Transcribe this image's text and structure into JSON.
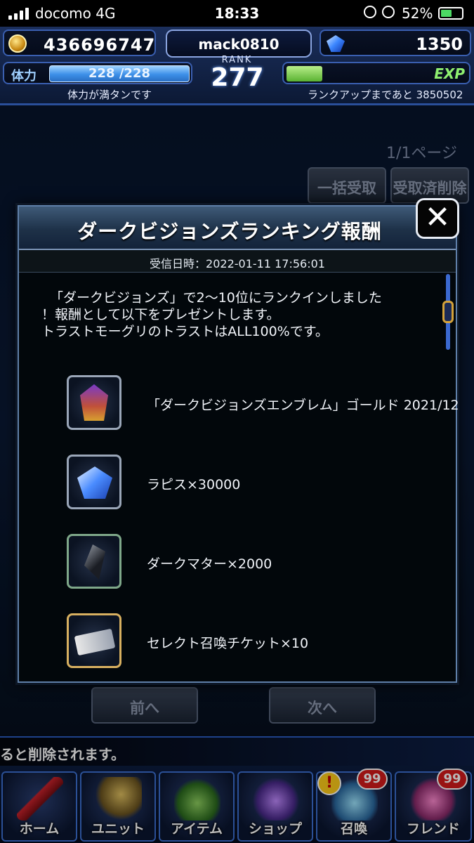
{
  "status_bar": {
    "carrier": "docomo   4G",
    "time": "18:33",
    "battery": "52%"
  },
  "header": {
    "gil": "436696747",
    "player_name": "mack0810",
    "lapis": "1350",
    "rank_label": "RANK",
    "rank": "277",
    "stamina_label": "体力",
    "stamina": "228 /228",
    "stamina_status": "体力が満タンです",
    "exp_label": "EXP",
    "exp_fill": 0.2,
    "rank_up_remaining": "ランクアップまであと 3850502"
  },
  "background_page": {
    "page_indicator": "1/1ページ",
    "bulk_receive": "一括受取",
    "delete_received": "受取済削除",
    "prev": "前へ",
    "next": "次へ",
    "notice": "ると削除されます。"
  },
  "modal": {
    "title": "ダークビジョンズランキング報酬",
    "received_at": "受信日時：2022-01-11  17:56:01",
    "message_lines": [
      "「ダークビジョンズ」で2〜10位にランクインしました",
      "！報酬として以下をプレゼントします。",
      "トラストモーグリのトラストはALL100%です。"
    ],
    "rewards": [
      {
        "label": "「ダークビジョンズエンブレム」ゴールド 2021/12",
        "icon": "emblem-icon"
      },
      {
        "label": "ラピス×30000",
        "icon": "lapis-icon"
      },
      {
        "label": "ダークマター×2000",
        "icon": "dark-matter-icon"
      },
      {
        "label": "セレクト召喚チケット×10",
        "icon": "ticket-icon"
      }
    ],
    "close": "✕"
  },
  "nav": [
    {
      "label": "ホーム",
      "icon": "home-icon"
    },
    {
      "label": "ユニット",
      "icon": "unit-icon"
    },
    {
      "label": "アイテム",
      "icon": "item-icon"
    },
    {
      "label": "ショップ",
      "icon": "shop-icon"
    },
    {
      "label": "召喚",
      "icon": "summon-icon",
      "badge": "99",
      "alert": "!"
    },
    {
      "label": "フレンド",
      "icon": "friend-icon",
      "badge": "99"
    }
  ]
}
